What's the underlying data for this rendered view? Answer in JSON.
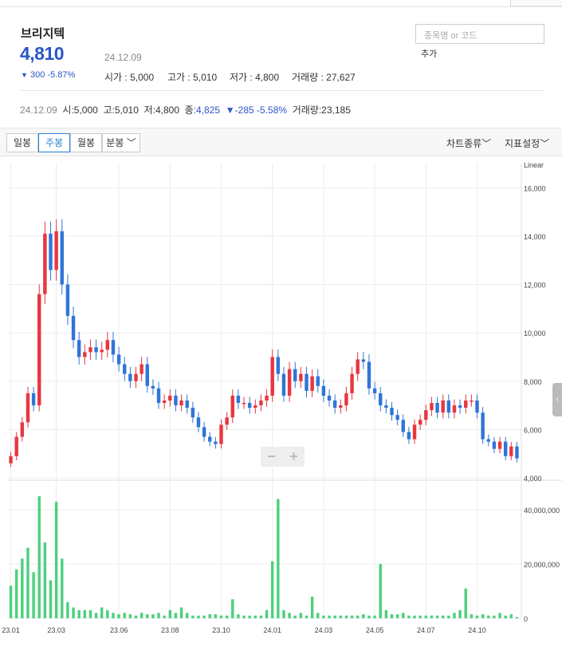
{
  "stock": {
    "name": "브리지텍",
    "price": "4,810",
    "date": "24.12.09",
    "change_arrow": "▼",
    "change": "300",
    "change_pct": "-5.87%",
    "open_label": "시가",
    "open": "5,000",
    "high_label": "고가",
    "high": "5,010",
    "low_label": "저가",
    "low": "4,800",
    "volume_label": "거래량",
    "volume": "27,627"
  },
  "search": {
    "placeholder": "종목명 or 코드",
    "add_label": "추가"
  },
  "candle_info": {
    "date": "24.12.09",
    "open_label": "시",
    "open": ":5,000",
    "high_label": "고",
    "high": ":5,010",
    "low_label": "저",
    "low": ":4,800",
    "close_label": "종",
    "close": ":4,825",
    "change": "▼-285",
    "change_pct": "-5.58%",
    "volume_label": "거래량",
    "volume": ":23,185"
  },
  "toolbar": {
    "daily": "일봉",
    "weekly": "주봉",
    "monthly": "월봉",
    "minute": "분봉 ﹀",
    "chart_type": "차트종류﹀",
    "indicator": "지표설정﹀"
  },
  "zoom": {
    "minus": "−",
    "plus": "+"
  },
  "colors": {
    "up": "#e8363f",
    "down": "#2f75d6",
    "volume": "#4cd07d",
    "grid": "#ececec"
  },
  "chart_data": {
    "type": "candlestick",
    "scale_label": "Linear",
    "price_ticks": [
      "4,000",
      "6,000",
      "8,000",
      "10,000",
      "12,000",
      "14,000",
      "16,000"
    ],
    "price_tick_values": [
      4000,
      6000,
      8000,
      10000,
      12000,
      14000,
      16000
    ],
    "price_range": [
      4000,
      17000
    ],
    "volume_ticks": [
      "0",
      "20,000,000",
      "40,000,000"
    ],
    "volume_tick_values": [
      0,
      20000000,
      40000000
    ],
    "volume_range": [
      0,
      50000000
    ],
    "x_labels": [
      "23.01",
      "23.03",
      "23.06",
      "23.08",
      "23.10",
      "24.01",
      "24.03",
      "24.05",
      "24.07",
      "24.10"
    ],
    "close": [
      4900,
      5700,
      6300,
      7500,
      7000,
      11600,
      14100,
      12600,
      14200,
      12000,
      10700,
      9700,
      9000,
      9200,
      9400,
      9200,
      9300,
      9700,
      9100,
      8700,
      8300,
      8000,
      8300,
      8700,
      7800,
      7700,
      7100,
      7200,
      7400,
      7000,
      7200,
      6900,
      6500,
      6100,
      5700,
      5500,
      5400,
      6200,
      6500,
      7400,
      7100,
      7100,
      6900,
      7000,
      7200,
      7400,
      9000,
      8300,
      7400,
      8500,
      8000,
      8300,
      7600,
      8200,
      7800,
      7400,
      7200,
      6900,
      7000,
      7500,
      8300,
      8900,
      8800,
      7700,
      7500,
      7000,
      6900,
      6600,
      6400,
      5900,
      5600,
      6200,
      6400,
      6800,
      7100,
      6700,
      7200,
      6700,
      7000,
      6900,
      7200,
      7200,
      6700,
      5600,
      5500,
      5200,
      5500,
      4900,
      5300,
      4810
    ],
    "volume": [
      12000000,
      18000000,
      22000000,
      26000000,
      17000000,
      45000000,
      28000000,
      14000000,
      43000000,
      22000000,
      6000000,
      4000000,
      3000000,
      3000000,
      3000000,
      2000000,
      4000000,
      3000000,
      2000000,
      1500000,
      2000000,
      1500000,
      1000000,
      2000000,
      1500000,
      1500000,
      2000000,
      1000000,
      3000000,
      2000000,
      4000000,
      2000000,
      1000000,
      1000000,
      1000000,
      1500000,
      1500000,
      1000000,
      1000000,
      7000000,
      1500000,
      1000000,
      1000000,
      1000000,
      1000000,
      3000000,
      21000000,
      44000000,
      3000000,
      2000000,
      1000000,
      2000000,
      1000000,
      8000000,
      2000000,
      1000000,
      1000000,
      1000000,
      1000000,
      1000000,
      1000000,
      1000000,
      1500000,
      1000000,
      1000000,
      20000000,
      3000000,
      1500000,
      1500000,
      2000000,
      1000000,
      1000000,
      1000000,
      1000000,
      1000000,
      1000000,
      1000000,
      1000000,
      2000000,
      3000000,
      11000000,
      1500000,
      1000000,
      1500000,
      1000000,
      1000000,
      2000000,
      1000000,
      1500000,
      500000
    ]
  }
}
